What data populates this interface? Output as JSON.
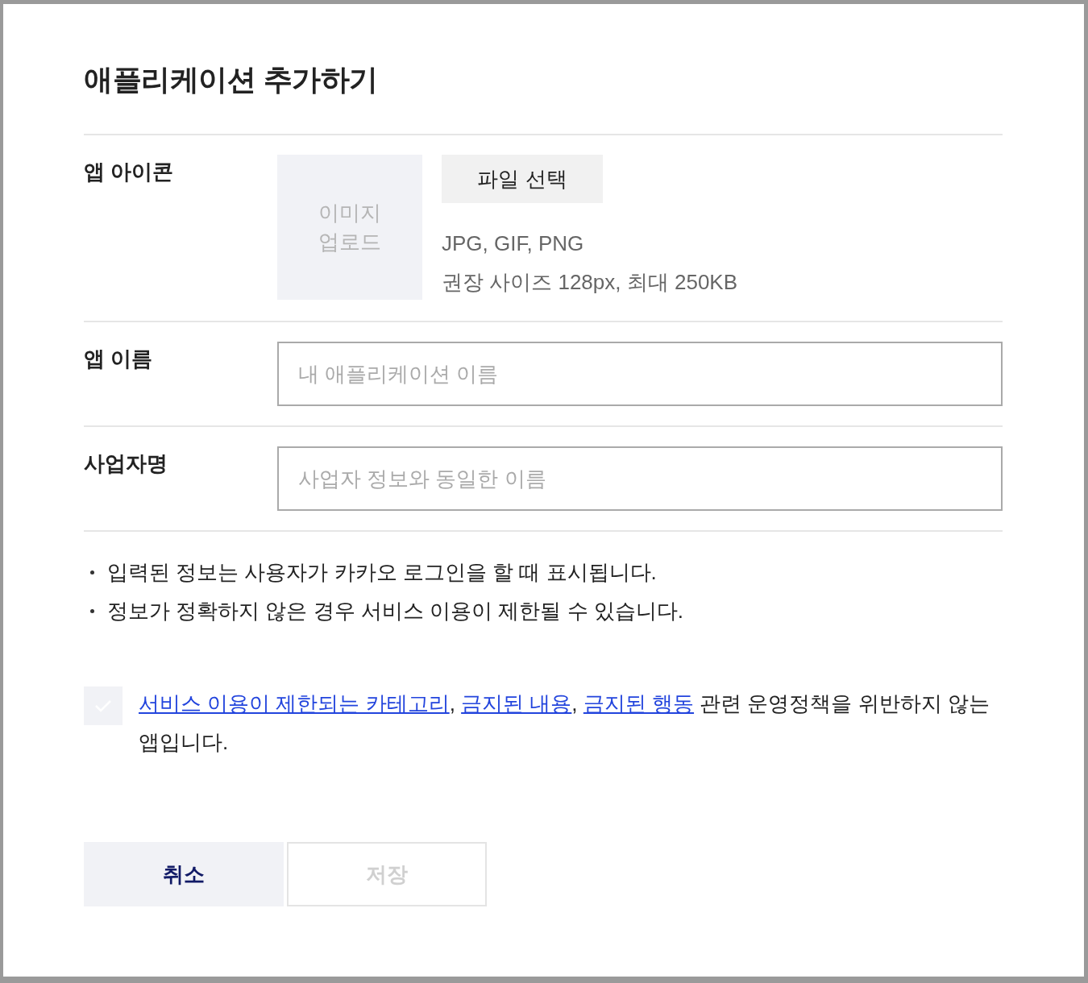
{
  "dialog": {
    "title": "애플리케이션 추가하기"
  },
  "icon_row": {
    "label": "앱 아이콘",
    "upload_lines": [
      "이미지",
      "업로드"
    ],
    "file_button": "파일 선택",
    "hints": [
      "JPG, GIF, PNG",
      "권장 사이즈 128px, 최대 250KB"
    ]
  },
  "fields": [
    {
      "label": "앱 이름",
      "placeholder": "내 애플리케이션 이름"
    },
    {
      "label": "사업자명",
      "placeholder": "사업자 정보와 동일한 이름"
    }
  ],
  "notes": [
    "입력된 정보는 사용자가 카카오 로그인을 할 때 표시됩니다.",
    "정보가 정확하지 않은 경우 서비스 이용이 제한될 수 있습니다."
  ],
  "consent": {
    "checked": false,
    "parts": [
      {
        "kind": "link",
        "text": "서비스 이용이 제한되는 카테고리"
      },
      {
        "kind": "text",
        "text": ", "
      },
      {
        "kind": "link",
        "text": "금지된 내용"
      },
      {
        "kind": "text",
        "text": ", "
      },
      {
        "kind": "link",
        "text": "금지된 행동"
      },
      {
        "kind": "text",
        "text": " 관련 운영정책을 위반하지 않는 앱입니다."
      }
    ]
  },
  "buttons": [
    {
      "label": "취소",
      "kind": "secondary",
      "disabled": false
    },
    {
      "label": "저장",
      "kind": "primary",
      "disabled": true
    }
  ]
}
